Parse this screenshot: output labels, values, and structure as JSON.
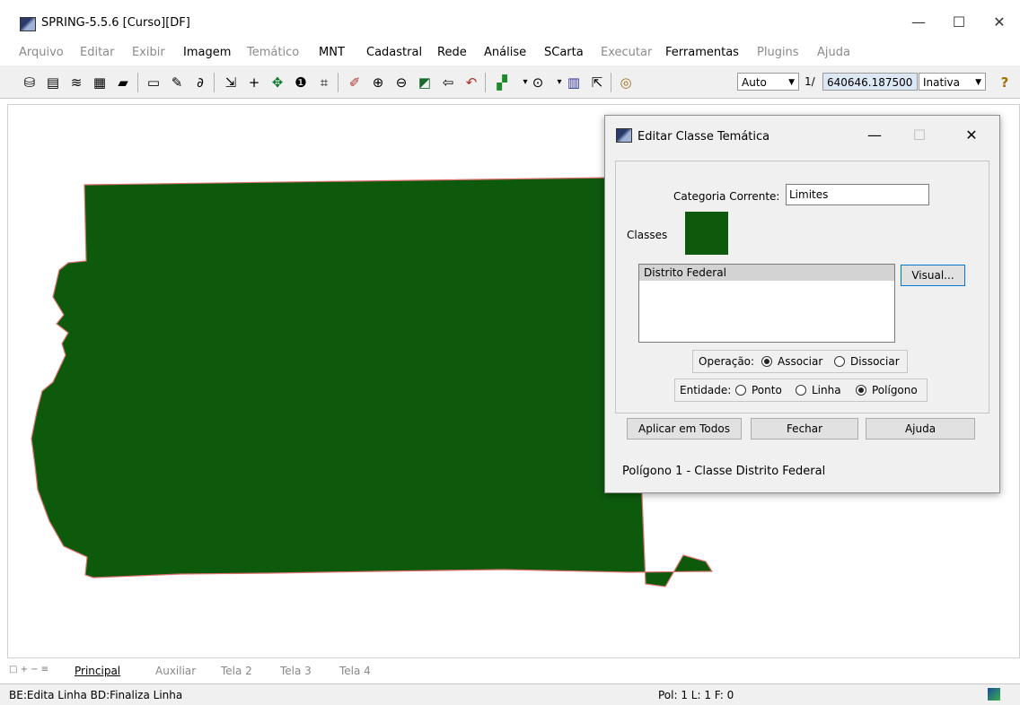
{
  "window": {
    "title": "SPRING-5.5.6 [Curso][DF]",
    "minimize": "—",
    "maximize": "☐",
    "close": "✕"
  },
  "menu": [
    "Arquivo",
    "Editar",
    "Exibir",
    "Imagem",
    "Temático",
    "MNT",
    "Cadastral",
    "Rede",
    "Análise",
    "SCarta",
    "Executar",
    "Ferramentas",
    "Plugins",
    "Ajuda"
  ],
  "toolbar": {
    "scale_mode": "Auto",
    "scale_prefix": "1/",
    "scale_value": "640646.187500",
    "state": "Inativa",
    "help_icon": "?"
  },
  "colors": {
    "polygon": "#0d5a0d",
    "outline": "#e07070",
    "class_swatch": "#0d5a0d"
  },
  "dialog": {
    "title": "Editar Classe Temática",
    "category_label": "Categoria Corrente:",
    "category_value": "Limites",
    "classes_label": "Classes",
    "classes": [
      "Distrito Federal"
    ],
    "visual_button": "Visual...",
    "operation_label": "Operação:",
    "op_associate": "Associar",
    "op_dissociate": "Dissociar",
    "entity_label": "Entidade:",
    "ent_point": "Ponto",
    "ent_line": "Linha",
    "ent_polygon": "Polígono",
    "apply_all": "Aplicar em Todos",
    "close": "Fechar",
    "help": "Ajuda",
    "status": "Polígono 1 - Classe Distrito Federal"
  },
  "tabs": {
    "controls": "□ + − ≡",
    "items": [
      "Principal",
      "Auxiliar",
      "Tela 2",
      "Tela 3",
      "Tela 4"
    ]
  },
  "status": {
    "left": "BE:Edita Linha  BD:Finaliza Linha",
    "center": "Pol: 1 L: 1 F: 0"
  }
}
